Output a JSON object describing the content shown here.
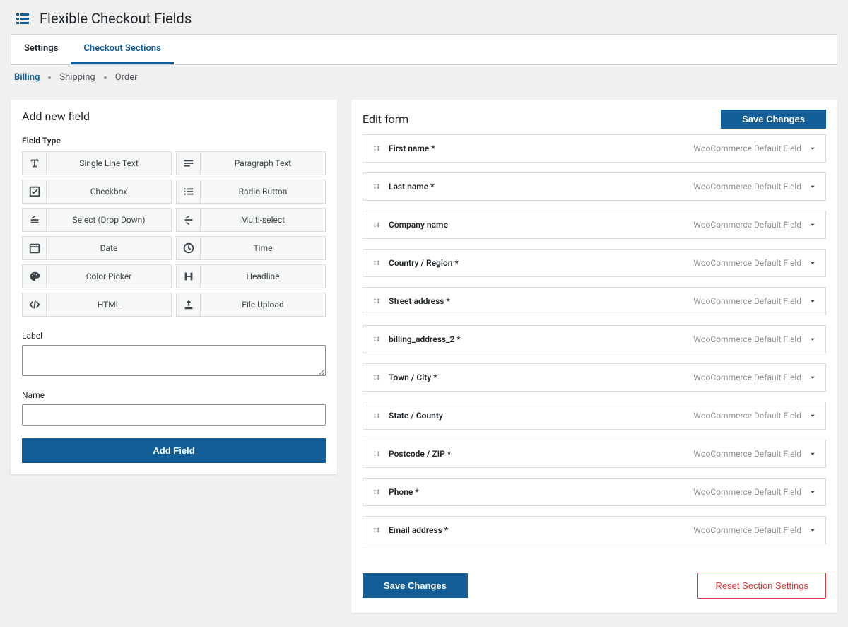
{
  "header": {
    "title": "Flexible Checkout Fields"
  },
  "tabs": [
    {
      "label": "Settings",
      "active": false
    },
    {
      "label": "Checkout Sections",
      "active": true
    }
  ],
  "subnav": [
    {
      "label": "Billing",
      "active": true
    },
    {
      "label": "Shipping",
      "active": false
    },
    {
      "label": "Order",
      "active": false
    }
  ],
  "left": {
    "title": "Add new field",
    "field_type_label": "Field Type",
    "field_types": [
      {
        "label": "Single Line Text",
        "icon": "text-icon"
      },
      {
        "label": "Paragraph Text",
        "icon": "paragraph-icon"
      },
      {
        "label": "Checkbox",
        "icon": "checkbox-icon"
      },
      {
        "label": "Radio Button",
        "icon": "radio-icon"
      },
      {
        "label": "Select (Drop Down)",
        "icon": "select-icon"
      },
      {
        "label": "Multi-select",
        "icon": "multiselect-icon"
      },
      {
        "label": "Date",
        "icon": "calendar-icon"
      },
      {
        "label": "Time",
        "icon": "clock-icon"
      },
      {
        "label": "Color Picker",
        "icon": "palette-icon"
      },
      {
        "label": "Headline",
        "icon": "heading-icon"
      },
      {
        "label": "HTML",
        "icon": "code-icon"
      },
      {
        "label": "File Upload",
        "icon": "upload-icon"
      }
    ],
    "label_label": "Label",
    "name_label": "Name",
    "add_button": "Add Field"
  },
  "right": {
    "title": "Edit form",
    "save_button": "Save Changes",
    "badge": "WooCommerce Default Field",
    "fields": [
      {
        "name": "First name *"
      },
      {
        "name": "Last name *"
      },
      {
        "name": "Company name"
      },
      {
        "name": "Country / Region *"
      },
      {
        "name": "Street address *"
      },
      {
        "name": "billing_address_2 *"
      },
      {
        "name": "Town / City *"
      },
      {
        "name": "State / County"
      },
      {
        "name": "Postcode / ZIP *"
      },
      {
        "name": "Phone *"
      },
      {
        "name": "Email address *"
      }
    ],
    "footer": {
      "save": "Save Changes",
      "reset": "Reset Section Settings"
    }
  }
}
